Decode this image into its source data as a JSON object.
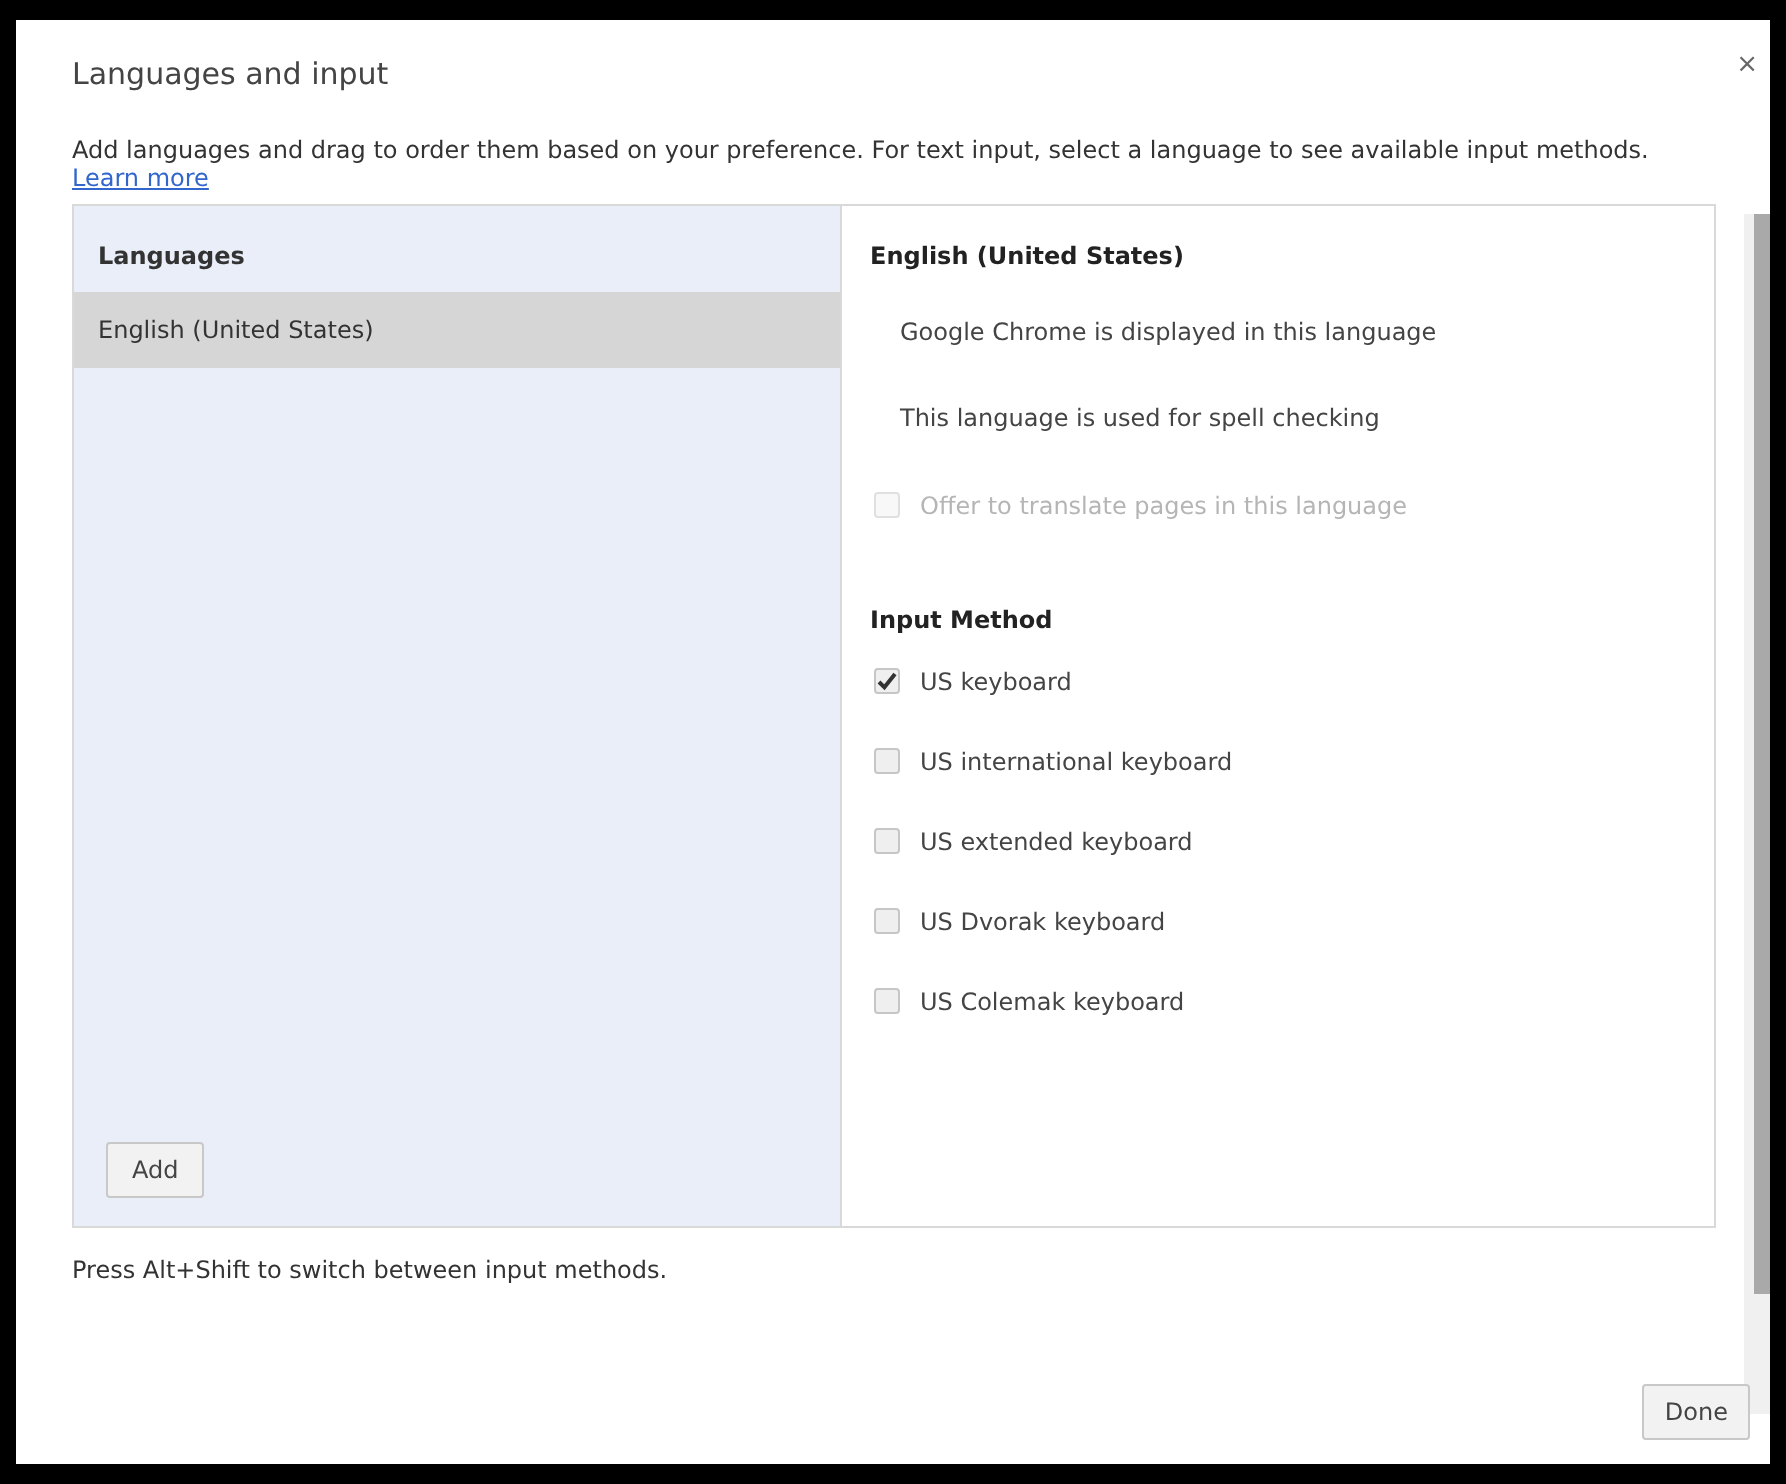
{
  "dialog": {
    "title": "Languages and input",
    "close": "×",
    "description": "Add languages and drag to order them based on your preference. For text input, select a language to see available input methods.",
    "learn_more": "Learn more"
  },
  "languages": {
    "heading": "Languages",
    "items": [
      {
        "label": "English (United States)",
        "selected": true
      }
    ],
    "add_button": "Add"
  },
  "details": {
    "title": "English (United States)",
    "notes": [
      "Google Chrome is displayed in this language",
      "This language is used for spell checking"
    ],
    "translate": {
      "label": "Offer to translate pages in this language",
      "checked": false,
      "disabled": true
    },
    "input_heading": "Input Method",
    "input_methods": [
      {
        "label": "US keyboard",
        "checked": true
      },
      {
        "label": "US international keyboard",
        "checked": false
      },
      {
        "label": "US extended keyboard",
        "checked": false
      },
      {
        "label": "US Dvorak keyboard",
        "checked": false
      },
      {
        "label": "US Colemak keyboard",
        "checked": false
      }
    ]
  },
  "hint": "Press Alt+Shift to switch between input methods.",
  "done_button": "Done"
}
